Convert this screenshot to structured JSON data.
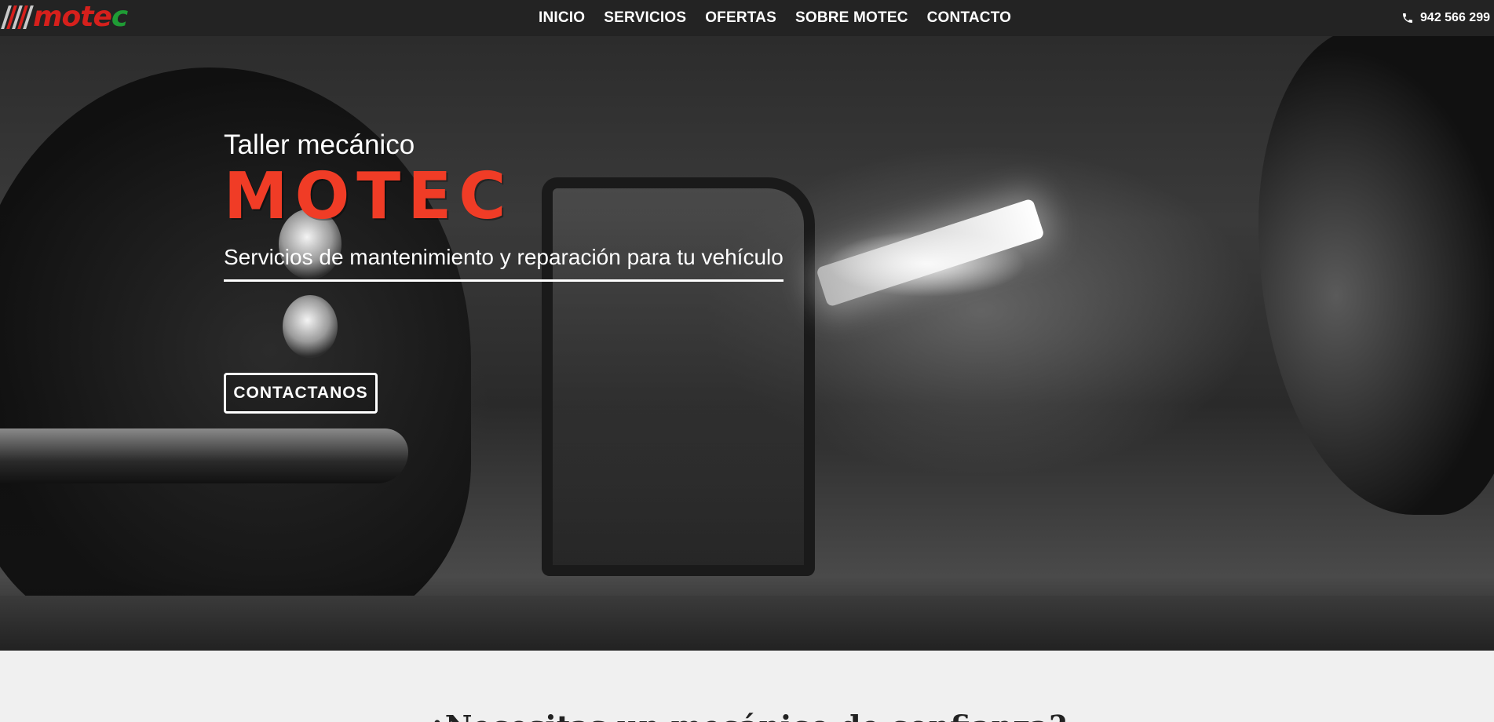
{
  "header": {
    "logo": {
      "text_part1": "mote",
      "text_part2": "c",
      "stripe_colors": [
        "#c8c8c8",
        "#d6201c",
        "#c8c8c8",
        "#d6201c",
        "#c8c8c8"
      ]
    },
    "nav": [
      {
        "label": "INICIO"
      },
      {
        "label": "SERVICIOS"
      },
      {
        "label": "OFERTAS"
      },
      {
        "label": "SOBRE MOTEC"
      },
      {
        "label": "CONTACTO"
      }
    ],
    "phone": {
      "icon": "phone-icon",
      "number": "942 566 299"
    }
  },
  "hero": {
    "eyebrow": "Taller mecánico",
    "title": "MOTEC",
    "subtitle": "Servicios de mantenimiento y reparación para tu vehículo",
    "cta_label": "CONTACTANOS"
  },
  "next_section": {
    "heading": "¿Necesitas un mecánico de confianza?"
  },
  "colors": {
    "accent": "#f03c26",
    "nav_bg": "#232323",
    "page_bg": "#f0f0f0"
  }
}
